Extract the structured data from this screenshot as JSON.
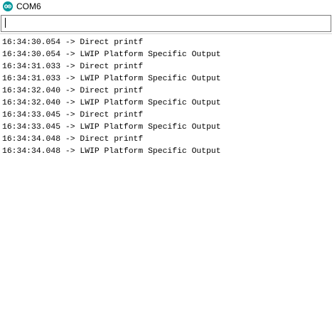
{
  "window": {
    "title": "COM6",
    "icon": "arduino-infinity-icon",
    "accent_color": "#00979c"
  },
  "input": {
    "value": ""
  },
  "output": {
    "lines": [
      "16:34:30.054 -> Direct printf",
      "16:34:30.054 -> LWIP Platform Specific Output",
      "16:34:31.033 -> Direct printf",
      "16:34:31.033 -> LWIP Platform Specific Output",
      "16:34:32.040 -> Direct printf",
      "16:34:32.040 -> LWIP Platform Specific Output",
      "16:34:33.045 -> Direct printf",
      "16:34:33.045 -> LWIP Platform Specific Output",
      "16:34:34.048 -> Direct printf",
      "16:34:34.048 -> LWIP Platform Specific Output"
    ]
  }
}
